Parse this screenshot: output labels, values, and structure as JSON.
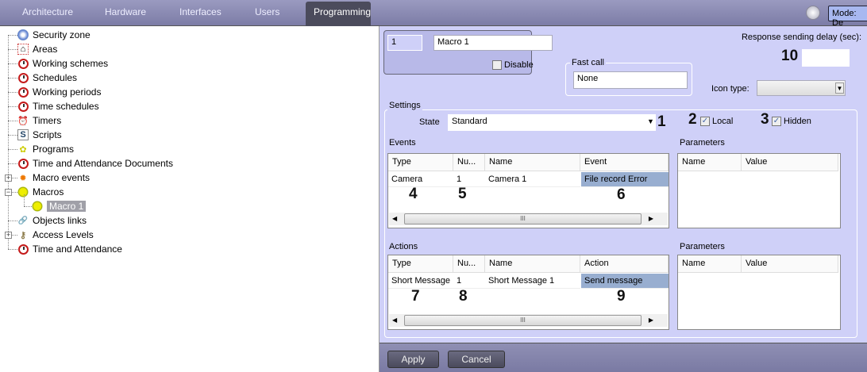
{
  "tabs": [
    {
      "label": "Architecture"
    },
    {
      "label": "Hardware"
    },
    {
      "label": "Interfaces"
    },
    {
      "label": "Users"
    },
    {
      "label": "Programming",
      "active": true
    }
  ],
  "mode_label": "Mode: De",
  "tree": [
    {
      "label": "Security zone",
      "icon": "security-zone-icon"
    },
    {
      "label": "Areas",
      "icon": "house-icon"
    },
    {
      "label": "Working schemes",
      "icon": "clock-icon"
    },
    {
      "label": "Schedules",
      "icon": "clock-icon"
    },
    {
      "label": "Working periods",
      "icon": "clock-icon"
    },
    {
      "label": "Time schedules",
      "icon": "clock-icon"
    },
    {
      "label": "Timers",
      "icon": "alarm-clock-icon"
    },
    {
      "label": "Scripts",
      "icon": "script-icon"
    },
    {
      "label": "Programs",
      "icon": "programs-icon"
    },
    {
      "label": "Time and Attendance Documents",
      "icon": "clock-icon"
    },
    {
      "label": "Macro events",
      "icon": "macro-event-icon",
      "expander": "+"
    },
    {
      "label": "Macros",
      "icon": "gear-icon",
      "expander": "-"
    },
    {
      "label": "Macro 1",
      "icon": "gear-icon",
      "selected": true
    },
    {
      "label": "Objects links",
      "icon": "link-icon"
    },
    {
      "label": "Access Levels",
      "icon": "keys-icon",
      "expander": "+"
    },
    {
      "label": "Time and Attendance",
      "icon": "clock-icon"
    }
  ],
  "macro": {
    "id": "1",
    "name": "Macro 1",
    "disable_label": "Disable",
    "disabled": false
  },
  "fast_call": {
    "label": "Fast call",
    "value": "None"
  },
  "response_delay": {
    "label": "Response sending delay (sec):",
    "value": ""
  },
  "icon_type": {
    "label": "Icon type:",
    "value": ""
  },
  "settings": {
    "label": "Settings",
    "state_label": "State",
    "state_value": "Standard",
    "local_label": "Local",
    "local": true,
    "hidden_label": "Hidden",
    "hidden": true
  },
  "events": {
    "label": "Events",
    "columns": [
      "Type",
      "Nu...",
      "Name",
      "Event"
    ],
    "rows": [
      [
        "Camera",
        "1",
        "Camera 1",
        "File record Error"
      ]
    ]
  },
  "actions": {
    "label": "Actions",
    "columns": [
      "Type",
      "Nu...",
      "Name",
      "Action"
    ],
    "rows": [
      [
        "Short Message",
        "1",
        "Short Message 1",
        "Send message"
      ]
    ]
  },
  "parameters": {
    "label": "Parameters",
    "columns": [
      "Name",
      "Value"
    ]
  },
  "callouts": [
    "1",
    "2",
    "3",
    "4",
    "5",
    "6",
    "7",
    "8",
    "9",
    "10"
  ],
  "buttons": {
    "apply": "Apply",
    "cancel": "Cancel"
  },
  "colors": {
    "panel": "#cfd0f8",
    "selection": "#98aed0",
    "topbar": "#8a8ab2"
  }
}
